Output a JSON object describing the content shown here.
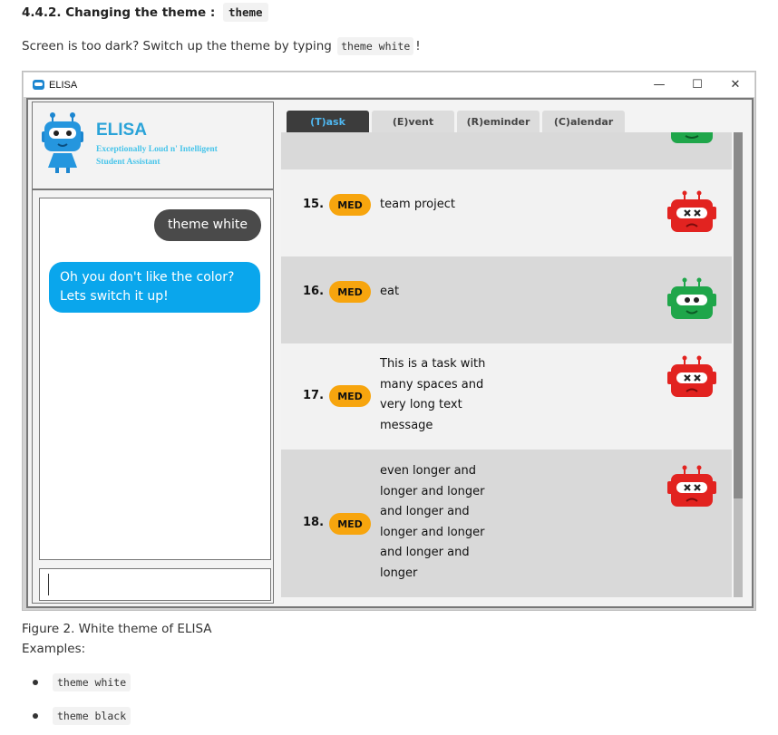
{
  "doc": {
    "heading": "4.4.2. Changing the theme :",
    "heading_code": "theme",
    "intro_before": "Screen is too dark? Switch up the theme by typing",
    "intro_code": "theme white",
    "intro_after": "!",
    "caption": "Figure 2. White theme of ELISA",
    "examples_label": "Examples:",
    "examples": [
      "theme white",
      "theme black"
    ]
  },
  "window": {
    "title": "ELISA",
    "controls": {
      "minimize": "—",
      "maximize": "☐",
      "close": "✕"
    }
  },
  "logo": {
    "name": "ELISA",
    "tagline_1": "Exceptionally Loud n' Intelligent",
    "tagline_2": "Student Assistant"
  },
  "chat": {
    "user_message": "theme white",
    "elisa_message": "Oh you don't like the color? Lets switch it up!"
  },
  "tabs": [
    "(T)ask",
    "(E)vent",
    "(R)eminder",
    "(C)alendar"
  ],
  "tasks": [
    {
      "number": "15.",
      "priority": "MED",
      "text": "team project",
      "robot": "red-robot-icon"
    },
    {
      "number": "16.",
      "priority": "MED",
      "text": "eat",
      "robot": "green-robot-icon"
    },
    {
      "number": "17.",
      "priority": "MED",
      "text": "This is a task with many spaces and very long text message",
      "robot": "red-robot-icon"
    },
    {
      "number": "18.",
      "priority": "MED",
      "text": "even longer and longer and longer and longer and longer and longer and longer and longer",
      "robot": "red-robot-icon"
    }
  ],
  "colors": {
    "accent": "#2aa3d8",
    "elisa_bubble": "#0aa6ec",
    "user_bubble": "#4a4a4a",
    "priority_med": "#f7a50e",
    "robot_done": "#1fa64a",
    "robot_undone": "#e22320",
    "active_tab": "#3c3c3c"
  }
}
